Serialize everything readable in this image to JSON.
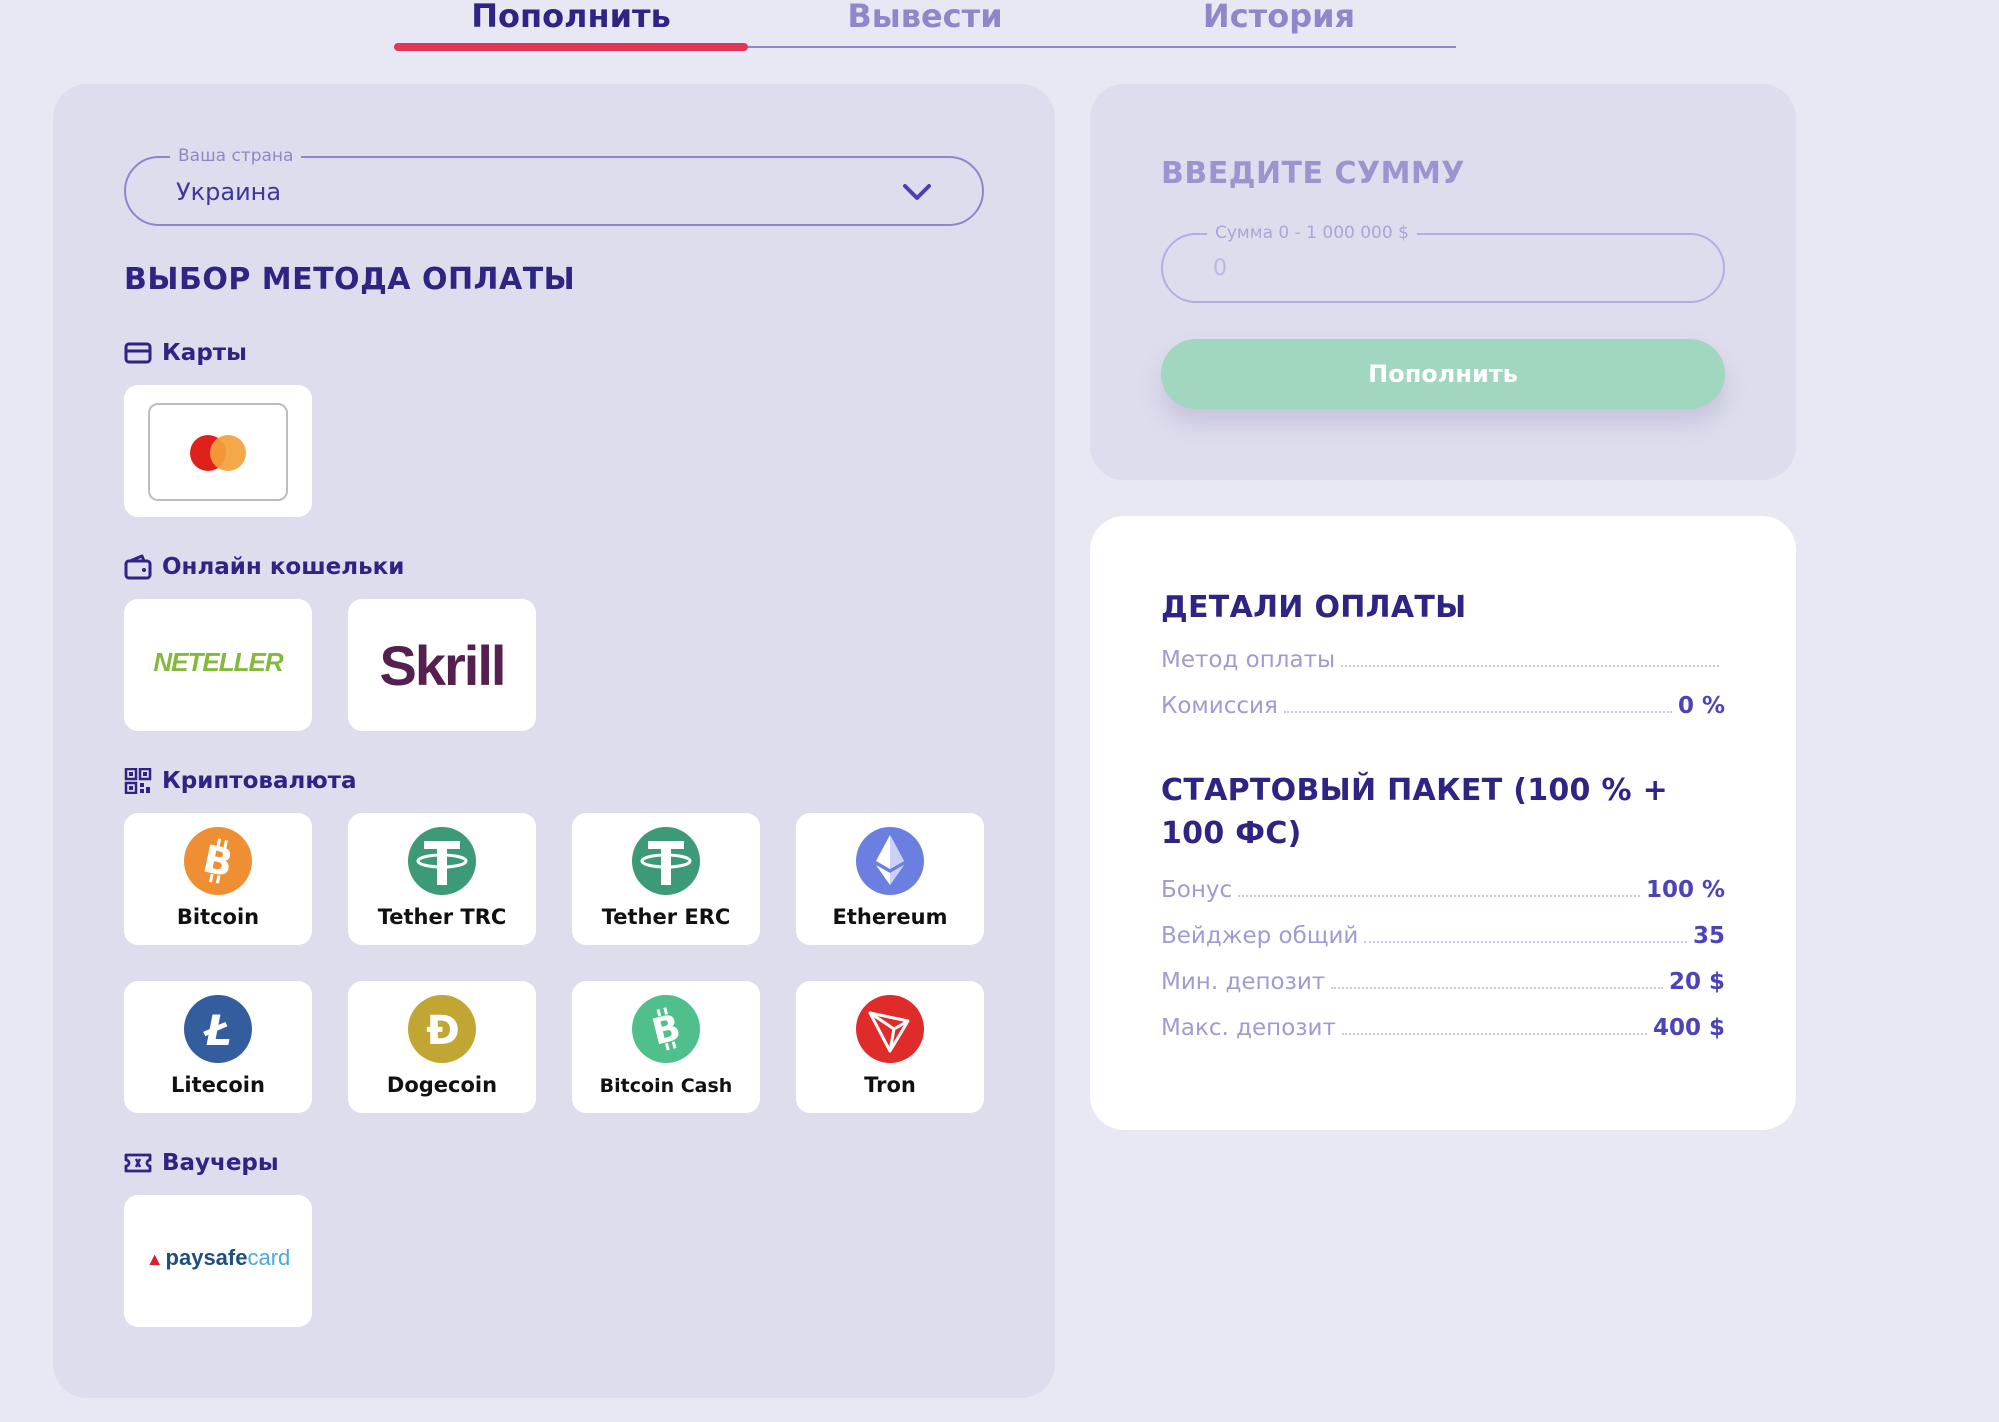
{
  "tabs": [
    {
      "label": "Пополнить",
      "active": true
    },
    {
      "label": "Вывести",
      "active": false
    },
    {
      "label": "История",
      "active": false
    }
  ],
  "country": {
    "legend": "Ваша страна",
    "value": "Украина"
  },
  "payment_method": {
    "title": "ВЫБОР МЕТОДА ОПЛАТЫ",
    "categories": {
      "cards": {
        "label": "Карты",
        "icon": "credit-card-icon"
      },
      "wallets": {
        "label": "Онлайн кошельки",
        "icon": "wallet-icon",
        "items": [
          "NETELLER",
          "Skrill"
        ]
      },
      "crypto": {
        "label": "Криптовалюта",
        "icon": "qr-code-icon",
        "items": [
          "Bitcoin",
          "Tether TRC",
          "Tether ERC",
          "Ethereum",
          "Litecoin",
          "Dogecoin",
          "Bitcoin Cash",
          "Tron"
        ]
      },
      "vouchers": {
        "label": "Ваучеры",
        "icon": "ticket-icon",
        "items": {
          "paysafe_a": "paysafe",
          "paysafe_b": "card"
        }
      }
    }
  },
  "amount": {
    "title": "ВВЕДИТЕ СУММУ",
    "legend": "Сумма 0 - 1 000 000 $",
    "placeholder": "0",
    "button": "Пополнить"
  },
  "details": {
    "title": "ДЕТАЛИ ОПЛАТЫ",
    "method_label": "Метод оплаты",
    "method_value": "",
    "commission_label": "Комиссия",
    "commission_value": "0 %"
  },
  "package": {
    "title": "СТАРТОВЫЙ ПАКЕТ (100 % + 100 ФС)",
    "rows": [
      {
        "label": "Бонус",
        "value": "100 %"
      },
      {
        "label": "Вейджер общий",
        "value": "35"
      },
      {
        "label": "Мин. депозит",
        "value": "20 $"
      },
      {
        "label": "Макс. депозит",
        "value": "400 $"
      }
    ]
  },
  "colors": {
    "accent": "#e2365a",
    "primary": "#2e2483",
    "button": "#a1d7bf",
    "background": "#e8e7f4"
  }
}
